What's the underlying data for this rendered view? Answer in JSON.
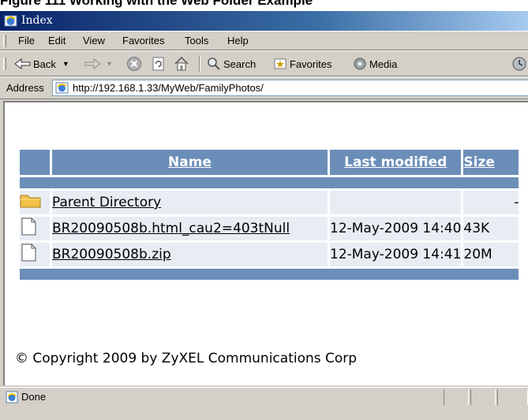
{
  "caption": "Figure 111 Working with the Web Folder Example",
  "window": {
    "title": "Index"
  },
  "menu": [
    "File",
    "Edit",
    "View",
    "Favorites",
    "Tools",
    "Help"
  ],
  "toolbar": {
    "back": "Back",
    "search": "Search",
    "favorites": "Favorites",
    "media": "Media"
  },
  "address": {
    "label": "Address",
    "url": "http://192.168.1.33/MyWeb/FamilyPhotos/"
  },
  "table": {
    "headers": {
      "name": "Name",
      "modified": "Last modified",
      "size": "Size"
    },
    "rows": [
      {
        "icon": "folder-icon",
        "name": "Parent Directory",
        "modified": "",
        "size": "-"
      },
      {
        "icon": "file-icon",
        "name": "BR20090508b.html_cau2=403tNull",
        "modified": "12-May-2009 14:40",
        "size": "43K"
      },
      {
        "icon": "file-icon",
        "name": "BR20090508b.zip",
        "modified": "12-May-2009 14:41",
        "size": "20M"
      }
    ]
  },
  "footer": "© Copyright 2009 by ZyXEL Communications Corp",
  "status": "Done",
  "colors": {
    "header_bg": "#6b8eb8",
    "row_bg": "#e8edf4",
    "titlebar": "#0a246a"
  }
}
